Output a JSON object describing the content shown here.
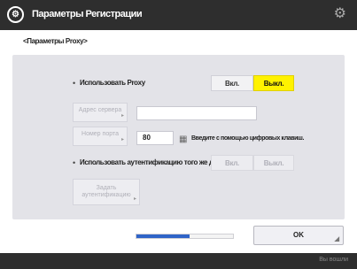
{
  "title": {
    "text": "Параметры Регистрации",
    "icon": "settings-circle-icon"
  },
  "header_icon": "gear-icon",
  "breadcrumb": "<Параметры Proxy>",
  "use_proxy": {
    "label": "Использовать Proxy",
    "on": "Вкл.",
    "off": "Выкл.",
    "selected": "Выкл."
  },
  "server_address": {
    "button": "Адрес сервера",
    "value": ""
  },
  "port_number": {
    "button": "Номер порта",
    "value": "80"
  },
  "hint": "Введите с помощью цифровых клавиш.",
  "auth": {
    "label": "Использовать аутентификацию того же домена",
    "on": "Вкл.",
    "off": "Выкл."
  },
  "set_auth_button": "Задать аутентификацию",
  "progress": {
    "percent": 55
  },
  "ok_label": "OK",
  "status": "Вы вошли",
  "colors": {
    "selected": "#fff200",
    "titlebar": "#2e2e2e",
    "progress": "#2f64c8"
  }
}
